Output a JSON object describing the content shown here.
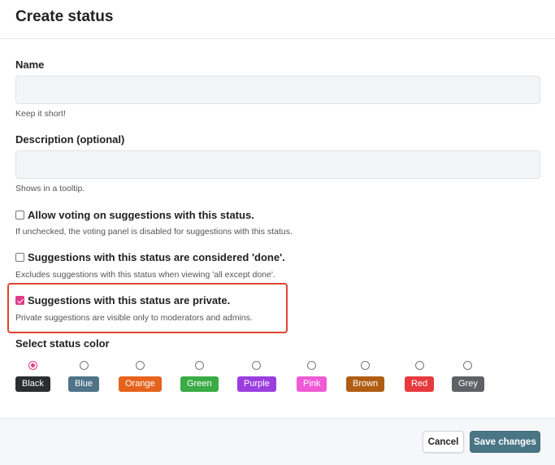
{
  "dialog": {
    "title": "Create status"
  },
  "name_field": {
    "label": "Name",
    "value": "",
    "placeholder": "",
    "help": "Keep it short!"
  },
  "description_field": {
    "label": "Description (optional)",
    "value": "",
    "placeholder": "",
    "help": "Shows in a tooltip."
  },
  "options": [
    {
      "label": "Allow voting on suggestions with this status.",
      "help": "If unchecked, the voting panel is disabled for suggestions with this status.",
      "checked": false
    },
    {
      "label": "Suggestions with this status are considered 'done'.",
      "help": "Excludes suggestions with this status when viewing 'all except done'.",
      "checked": false
    },
    {
      "label": "Suggestions with this status are private.",
      "help": "Private suggestions are visible only to moderators and admins.",
      "checked": true
    }
  ],
  "color_section": {
    "label": "Select status color",
    "selected": "Black",
    "colors": [
      {
        "name": "Black",
        "hex": "#2b2d31"
      },
      {
        "name": "Blue",
        "hex": "#4f7488"
      },
      {
        "name": "Orange",
        "hex": "#e5631c"
      },
      {
        "name": "Green",
        "hex": "#3bab45"
      },
      {
        "name": "Purple",
        "hex": "#9b3ee0"
      },
      {
        "name": "Pink",
        "hex": "#ef5bd4"
      },
      {
        "name": "Brown",
        "hex": "#b05d14"
      },
      {
        "name": "Red",
        "hex": "#e63a3f"
      },
      {
        "name": "Grey",
        "hex": "#5e6166"
      }
    ]
  },
  "footer": {
    "cancel_label": "Cancel",
    "save_label": "Save changes"
  },
  "accent_color": "#e23b8a",
  "highlight_color": "#e0442f"
}
